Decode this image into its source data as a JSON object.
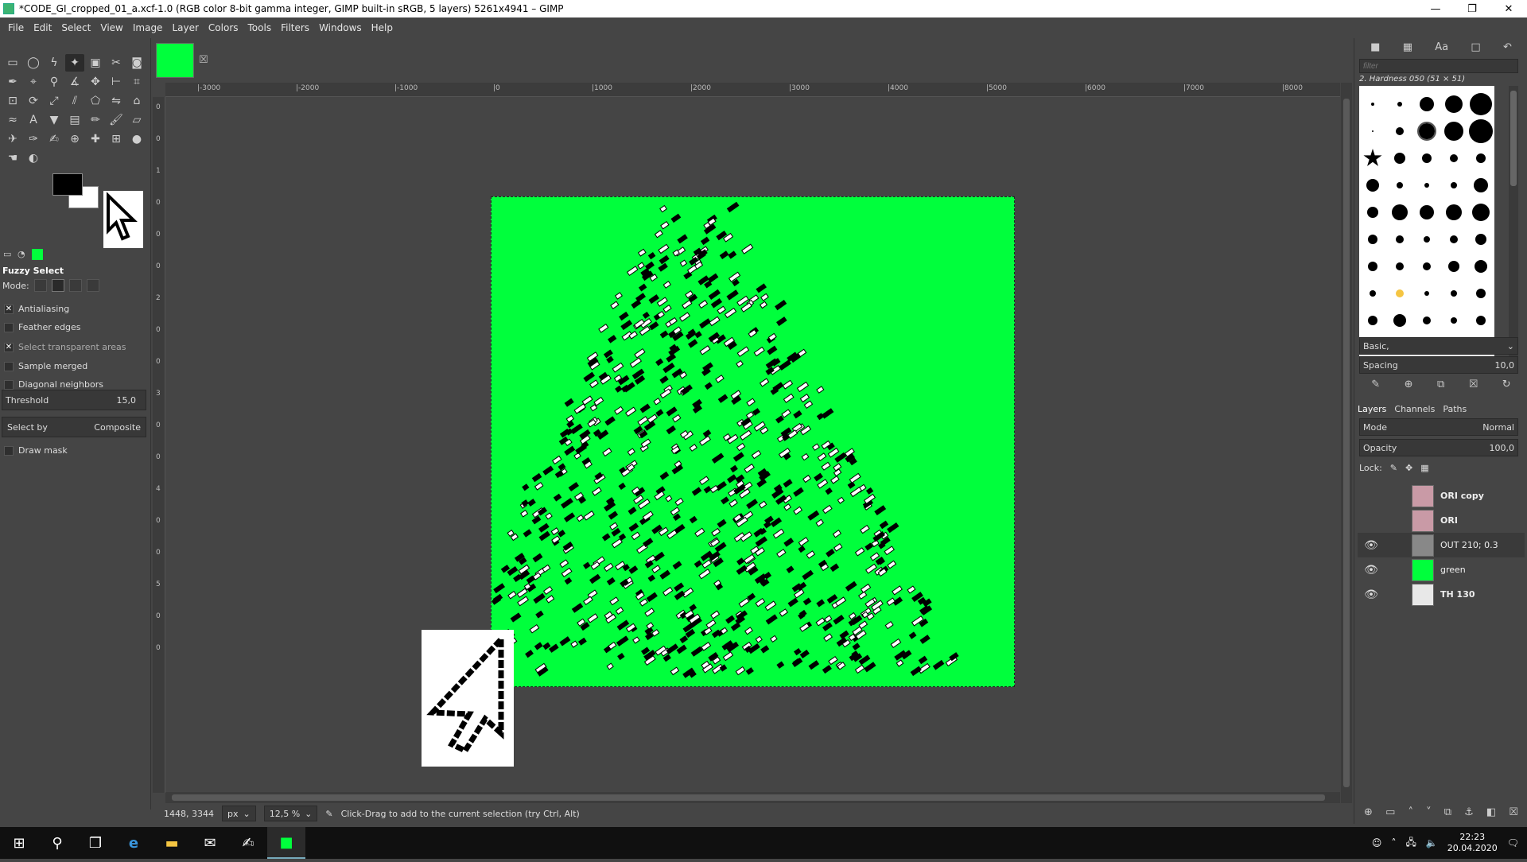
{
  "window": {
    "title": "*CODE_GI_cropped_01_a.xcf-1.0 (RGB color 8-bit gamma integer, GIMP built-in sRGB, 5 layers) 5261x4941 – GIMP",
    "minimize": "—",
    "maximize": "❐",
    "close": "✕"
  },
  "menu": [
    "File",
    "Edit",
    "Select",
    "View",
    "Image",
    "Layer",
    "Colors",
    "Tools",
    "Filters",
    "Windows",
    "Help"
  ],
  "toolbox": {
    "tool_icons": [
      "rect-select",
      "ellipse-select",
      "free-select",
      "fuzzy-select",
      "select-by-color",
      "scissors",
      "foreground-select",
      "paths",
      "color-picker",
      "zoom",
      "measure",
      "move",
      "align",
      "crop",
      "unified-transform",
      "rotate",
      "scale",
      "shear",
      "perspective",
      "flip",
      "cage",
      "warp",
      "text",
      "bucket-fill",
      "blend",
      "pencil",
      "paintbrush",
      "eraser",
      "airbrush",
      "ink",
      "mypaint",
      "clone",
      "heal",
      "perspective-clone",
      "blur",
      "smudge",
      "dodge-burn"
    ],
    "active_tool": "Fuzzy Select",
    "mode_label": "Mode:",
    "options": [
      {
        "label": "Antialiasing",
        "checked": true
      },
      {
        "label": "Feather edges",
        "checked": false
      },
      {
        "label": "Select transparent areas",
        "checked": true
      },
      {
        "label": "Sample merged",
        "checked": false
      },
      {
        "label": "Diagonal neighbors",
        "checked": false
      }
    ],
    "threshold_label": "Threshold",
    "threshold_value": "15,0",
    "select_by_label": "Select by",
    "select_by_value": "Composite",
    "draw_mask": "Draw mask"
  },
  "rulers": {
    "h": [
      "-3000",
      "-2000",
      "-1000",
      "0",
      "1000",
      "2000",
      "3000",
      "4000",
      "5000",
      "6000",
      "7000",
      "8000"
    ],
    "v": [
      "0",
      "0",
      "1",
      "0",
      "0",
      "0",
      "2",
      "0",
      "0",
      "3",
      "0",
      "0",
      "4",
      "0",
      "0",
      "5",
      "0",
      "0"
    ]
  },
  "status": {
    "coords": "1448, 3344",
    "unit": "px",
    "zoom": "12,5 %",
    "message": "Click-Drag to add to the current selection (try Ctrl, Alt)"
  },
  "brushes": {
    "filter_placeholder": "filter",
    "selected_brush": "2. Hardness 050 (51 × 51)",
    "preset": "Basic,",
    "spacing_label": "Spacing",
    "spacing_value": "10,0"
  },
  "layers_panel": {
    "tabs": [
      "Layers",
      "Channels",
      "Paths"
    ],
    "mode_label": "Mode",
    "mode_value": "Normal",
    "opacity_label": "Opacity",
    "opacity_value": "100,0",
    "lock_label": "Lock:",
    "layers": [
      {
        "name": "ORI copy",
        "visible": false,
        "thumb": "#c99aa6",
        "bold": true
      },
      {
        "name": "ORI",
        "visible": false,
        "thumb": "#c99aa6",
        "bold": true
      },
      {
        "name": "OUT 210; 0.3",
        "visible": true,
        "thumb": "#888888",
        "bold": false,
        "selected": true
      },
      {
        "name": "green",
        "visible": true,
        "thumb": "#00ff3c",
        "bold": false
      },
      {
        "name": "TH 130",
        "visible": true,
        "thumb": "#e8e8e8",
        "bold": true
      }
    ]
  },
  "taskbar": {
    "time": "22:23",
    "date": "20.04.2020"
  },
  "colors": {
    "canvas_green": "#00ff3c",
    "bg": "#454545"
  }
}
